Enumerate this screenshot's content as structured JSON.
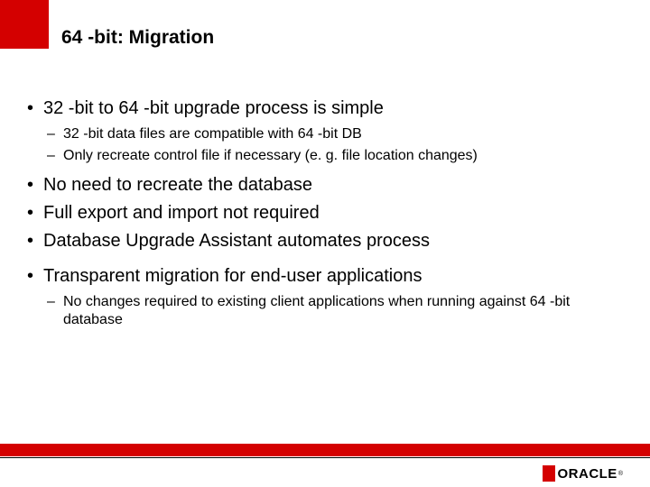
{
  "title": "64 -bit: Migration",
  "bullets": {
    "b1": "32 -bit to 64 -bit upgrade process is simple",
    "b1_1": "32 -bit data files are compatible with 64 -bit DB",
    "b1_2": "Only recreate control file if necessary (e. g. file location changes)",
    "b2": "No need to recreate the database",
    "b3": "Full export and import not required",
    "b4": "Database Upgrade Assistant automates process",
    "b5": "Transparent migration for end-user applications",
    "b5_1": "No changes required to existing client applications when running against 64 -bit database"
  },
  "logo": {
    "text": "ORACLE",
    "reg": "®"
  }
}
